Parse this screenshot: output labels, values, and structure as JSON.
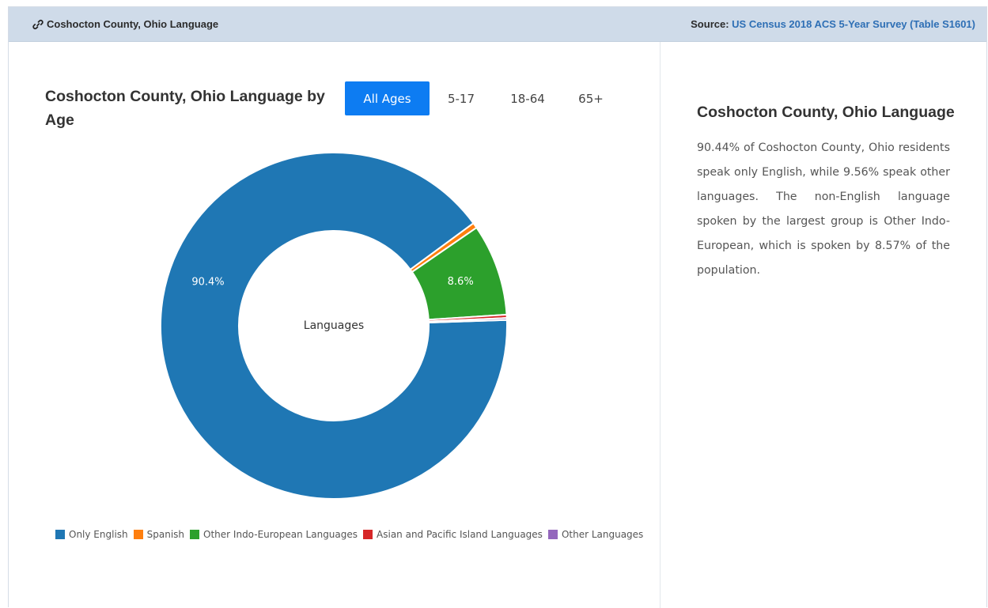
{
  "header": {
    "title": "Coshocton County, Ohio Language",
    "source_label": "Source:",
    "source_link": "US Census 2018 ACS 5-Year Survey (Table S1601)"
  },
  "chart_title": "Coshocton County, Ohio Language by Age",
  "tabs": [
    {
      "label": "All Ages",
      "active": true
    },
    {
      "label": "5-17",
      "active": false
    },
    {
      "label": "18-64",
      "active": false
    },
    {
      "label": "65+",
      "active": false
    }
  ],
  "chart_data": {
    "type": "pie",
    "donut": true,
    "center_label": "Languages",
    "legend_position": "bottom",
    "categories": [
      "Only English",
      "Spanish",
      "Other Indo-European Languages",
      "Asian and Pacific Island Languages",
      "Other Languages"
    ],
    "values": [
      90.44,
      0.5,
      8.57,
      0.3,
      0.19
    ],
    "data_labels": [
      "90.4%",
      "",
      "8.6%",
      "",
      ""
    ],
    "colors": [
      "#1f77b4",
      "#ff7f0e",
      "#2ca02c",
      "#d62728",
      "#9467bd"
    ]
  },
  "side_panel": {
    "title": "Coshocton County, Ohio Language",
    "text": "90.44% of Coshocton County, Ohio residents speak only English, while 9.56% speak other languages. The non-English language spoken by the largest group is Other Indo-European, which is spoken by 8.57% of the population."
  },
  "icons": {
    "header_link": "link-icon"
  }
}
